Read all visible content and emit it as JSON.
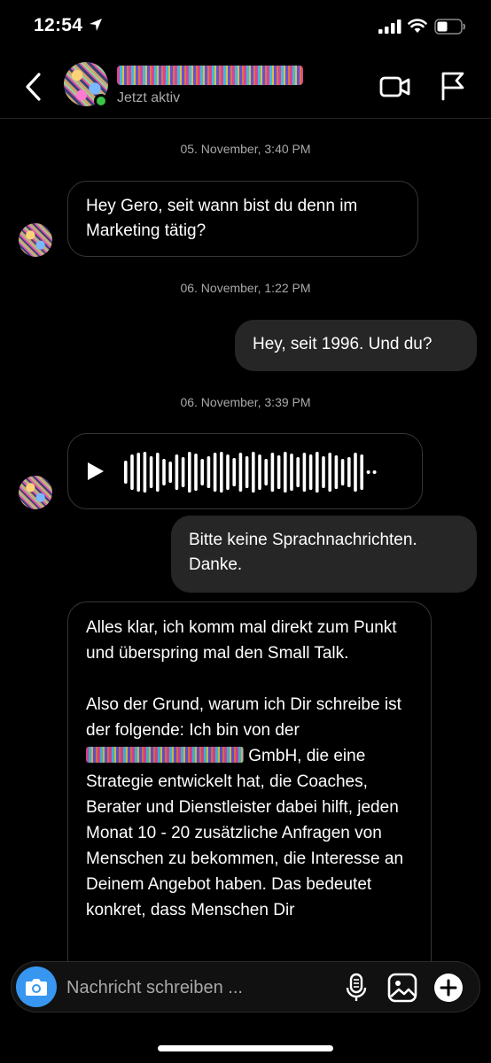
{
  "status_bar": {
    "time": "12:54"
  },
  "header": {
    "status": "Jetzt aktiv"
  },
  "messages": [
    {
      "type": "timestamp",
      "text": "05. November, 3:40 PM"
    },
    {
      "type": "incoming",
      "lines": [
        "Hey Gero, seit wann bist du denn im",
        "Marketing tätig?"
      ]
    },
    {
      "type": "timestamp",
      "text": "06. November, 1:22 PM"
    },
    {
      "type": "outgoing",
      "text": "Hey, seit 1996. Und du?"
    },
    {
      "type": "timestamp",
      "text": "06. November, 3:39 PM"
    },
    {
      "type": "voice",
      "direction": "incoming"
    },
    {
      "type": "outgoing",
      "lines": [
        "Bitte keine Sprachnachrichten.",
        "Danke."
      ]
    },
    {
      "type": "incoming_long",
      "paragraph1": "Alles klar, ich komm mal direkt zum Punkt und überspring mal den Small Talk.",
      "paragraph2_pre": "Also der Grund, warum ich Dir schreibe ist der folgende: Ich bin von der",
      "paragraph2_post": "GmbH, die eine Strategie entwickelt hat, die Coaches, Berater und Dienstleister dabei hilft, jeden Monat 10 - 20 zusätzliche Anfragen von Menschen zu bekommen, die Interesse an Deinem Angebot haben. Das bedeutet konkret, dass Menschen Dir"
    }
  ],
  "composer": {
    "placeholder": "Nachricht schreiben ..."
  },
  "colors": {
    "background": "#000000",
    "outgoing_bubble": "#262626",
    "incoming_border": "#363636",
    "secondary_text": "#a8a8a8",
    "active_dot": "#3ac447",
    "camera_button": "#3797f0"
  },
  "icons": [
    "location-arrow-icon",
    "signal-icon",
    "wifi-icon",
    "battery-icon",
    "back-chevron-icon",
    "video-call-icon",
    "flag-icon",
    "play-icon",
    "camera-icon",
    "microphone-icon",
    "gallery-icon",
    "plus-icon"
  ]
}
